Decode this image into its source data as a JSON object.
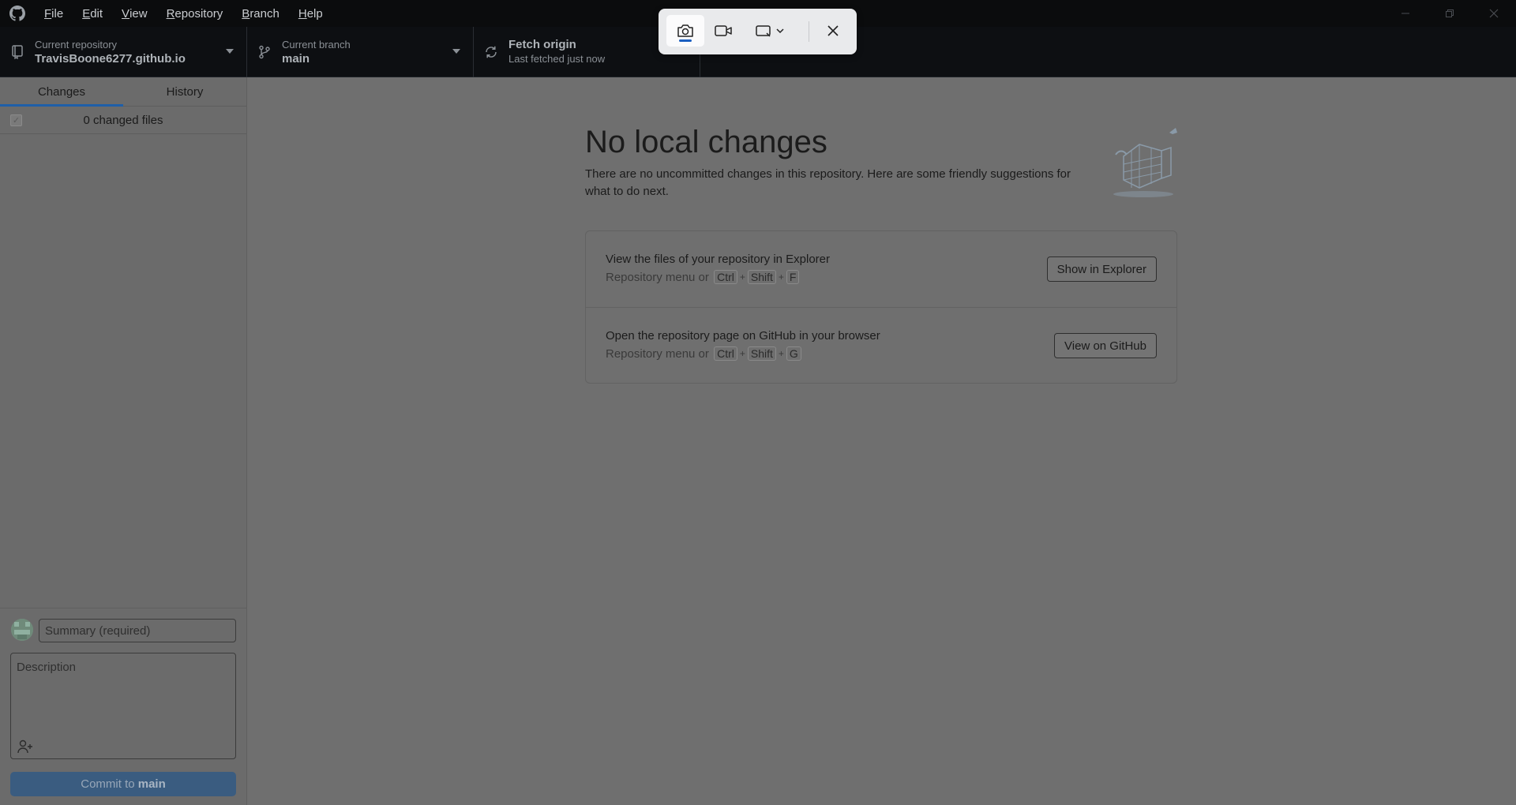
{
  "menu": [
    {
      "u": "F",
      "rest": "ile"
    },
    {
      "u": "E",
      "rest": "dit"
    },
    {
      "u": "V",
      "rest": "iew"
    },
    {
      "u": "R",
      "rest": "epository"
    },
    {
      "u": "B",
      "rest": "ranch"
    },
    {
      "u": "H",
      "rest": "elp"
    }
  ],
  "toolbar": {
    "repo_label": "Current repository",
    "repo_value": "TravisBoone6277.github.io",
    "branch_label": "Current branch",
    "branch_value": "main",
    "fetch_label": "Fetch origin",
    "fetch_sub": "Last fetched just now"
  },
  "sidebar": {
    "tabs": [
      "Changes",
      "History"
    ],
    "changed_files": "0 changed files",
    "summary_placeholder": "Summary (required)",
    "description_placeholder": "Description",
    "commit_prefix": "Commit to ",
    "commit_branch": "main"
  },
  "main": {
    "heading": "No local changes",
    "intro": "There are no uncommitted changes in this repository. Here are some friendly suggestions for what to do next.",
    "cards": [
      {
        "title": "View the files of your repository in Explorer",
        "sub_prefix": "Repository menu or",
        "keys": [
          "Ctrl",
          "Shift",
          "F"
        ],
        "button": "Show in Explorer"
      },
      {
        "title": "Open the repository page on GitHub in your browser",
        "sub_prefix": "Repository menu or",
        "keys": [
          "Ctrl",
          "Shift",
          "G"
        ],
        "button": "View on GitHub"
      }
    ]
  },
  "icons": {
    "app": "github-icon",
    "repo": "repo-icon",
    "branch": "branch-icon",
    "fetch": "sync-icon",
    "snip_camera": "camera-icon",
    "snip_video": "video-icon",
    "snip_mode": "rectangle-snip-icon",
    "snip_close": "close-icon"
  },
  "colors": {
    "accent": "#1f5fa8",
    "commit_button": "#3a5c80",
    "snip_active": "#1b5fc1"
  }
}
